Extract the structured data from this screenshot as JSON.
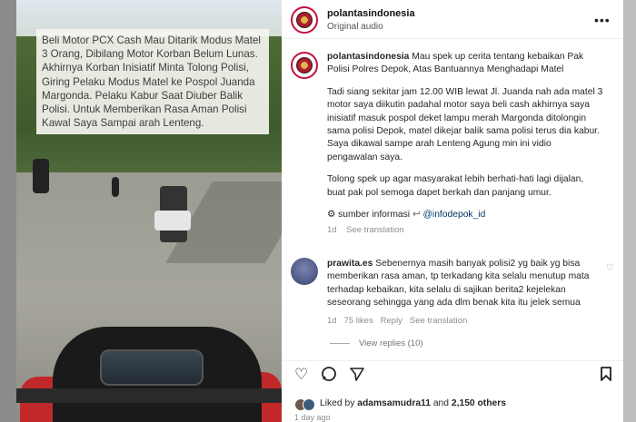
{
  "caption_overlay": "Beli Motor PCX Cash Mau Ditarik Modus Matel 3 Orang, Dibilang Motor Korban Belum Lunas. Akhirnya Korban Inisiatif Minta Tolong Polisi, Giring Pelaku Modus Matel ke Pospol Juanda Margonda. Pelaku Kabur Saat Diuber Balik Polisi. Untuk Memberikan Rasa Aman Polisi Kawal Saya Sampai arah Lenteng.",
  "header": {
    "username": "polantasindonesia",
    "audio": "Original audio",
    "more_icon": "more-horizontal-icon"
  },
  "post": {
    "username": "polantasindonesia",
    "paragraph1": "Mau spek up cerita tentang kebaikan Pak Polisi Polres Depok, Atas Bantuannya Menghadapi Matel",
    "paragraph2": "Tadi siang sekitar jam 12.00 WIB lewat Jl. Juanda nah ada matel 3 motor saya diikutin padahal motor saya beli cash akhirnya saya inisiatif masuk pospol deket lampu merah Margonda ditolongin sama polisi Depok, matel dikejar balik sama polisi terus dia kabur. Saya dikawal sampe arah Lenteng Agung min ini vidio pengawalan saya.",
    "paragraph3": "Tolong spek up agar masyarakat lebih berhati-hati lagi dijalan, buat pak pol semoga dapet berkah dan panjang umur.",
    "source_label": "sumber informasi",
    "source_handle": "@infodepok_id",
    "time": "1d",
    "see_translation": "See translation"
  },
  "comment": {
    "username": "prawita.es",
    "text": "Sebenernya masih banyak polisi2 yg baik yg bisa memberikan rasa aman, tp terkadang kita selalu menutup mata terhadap kebaikan, kita selalu di sajikan berita2 kejelekan seseorang sehingga yang ada dlm benak kita itu jelek semua",
    "time": "1d",
    "likes": "75 likes",
    "reply": "Reply",
    "see_translation": "See translation",
    "view_replies": "View replies (10)"
  },
  "actions": {
    "like_icon": "heart-icon",
    "comment_icon": "comment-icon",
    "share_icon": "send-icon",
    "save_icon": "bookmark-icon"
  },
  "likes": {
    "prefix": "Liked by",
    "user": "adamsamudra11",
    "middle": "and",
    "others": "2,150 others"
  },
  "posted_ago": "1 day ago",
  "colors": {
    "accent_link": "#00376b",
    "avatar_ring": "#c4123a",
    "muted": "#8e8e8e"
  }
}
